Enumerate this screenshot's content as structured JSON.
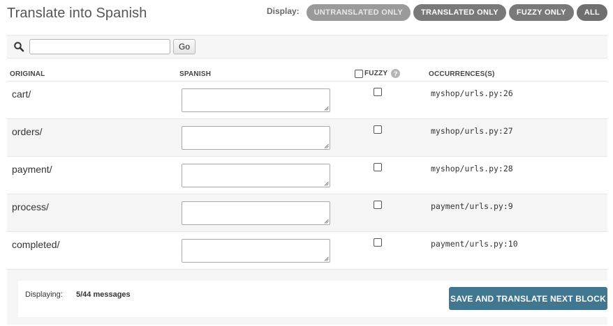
{
  "page": {
    "title": "Translate into Spanish"
  },
  "display": {
    "label": "Display:",
    "filters": [
      "UNTRANSLATED ONLY",
      "TRANSLATED ONLY",
      "FUZZY ONLY",
      "ALL"
    ],
    "active_filter": "UNTRANSLATED ONLY"
  },
  "search": {
    "value": "",
    "placeholder": "",
    "go_label": "Go",
    "icon": "search-icon"
  },
  "table": {
    "headers": {
      "original": "ORIGINAL",
      "spanish": "SPANISH",
      "fuzzy": "FUZZY",
      "occurrences": "OCCURRENCES(S)"
    },
    "rows": [
      {
        "original": "cart/",
        "translation": "",
        "fuzzy": false,
        "occurrences": "myshop/urls.py:26"
      },
      {
        "original": "orders/",
        "translation": "",
        "fuzzy": false,
        "occurrences": "myshop/urls.py:27"
      },
      {
        "original": "payment/",
        "translation": "",
        "fuzzy": false,
        "occurrences": "myshop/urls.py:28"
      },
      {
        "original": "process/",
        "translation": "",
        "fuzzy": false,
        "occurrences": "payment/urls.py:9"
      },
      {
        "original": "completed/",
        "translation": "",
        "fuzzy": false,
        "occurrences": "payment/urls.py:10"
      }
    ]
  },
  "footer": {
    "displaying_label": "Displaying:",
    "displaying_value": "5/44 messages",
    "save_label": "SAVE AND TRANSLATE NEXT BLOCK"
  },
  "colors": {
    "primary_button": "#417690",
    "filter_button": "#79797a",
    "row_alt": "#f5f5f5"
  }
}
